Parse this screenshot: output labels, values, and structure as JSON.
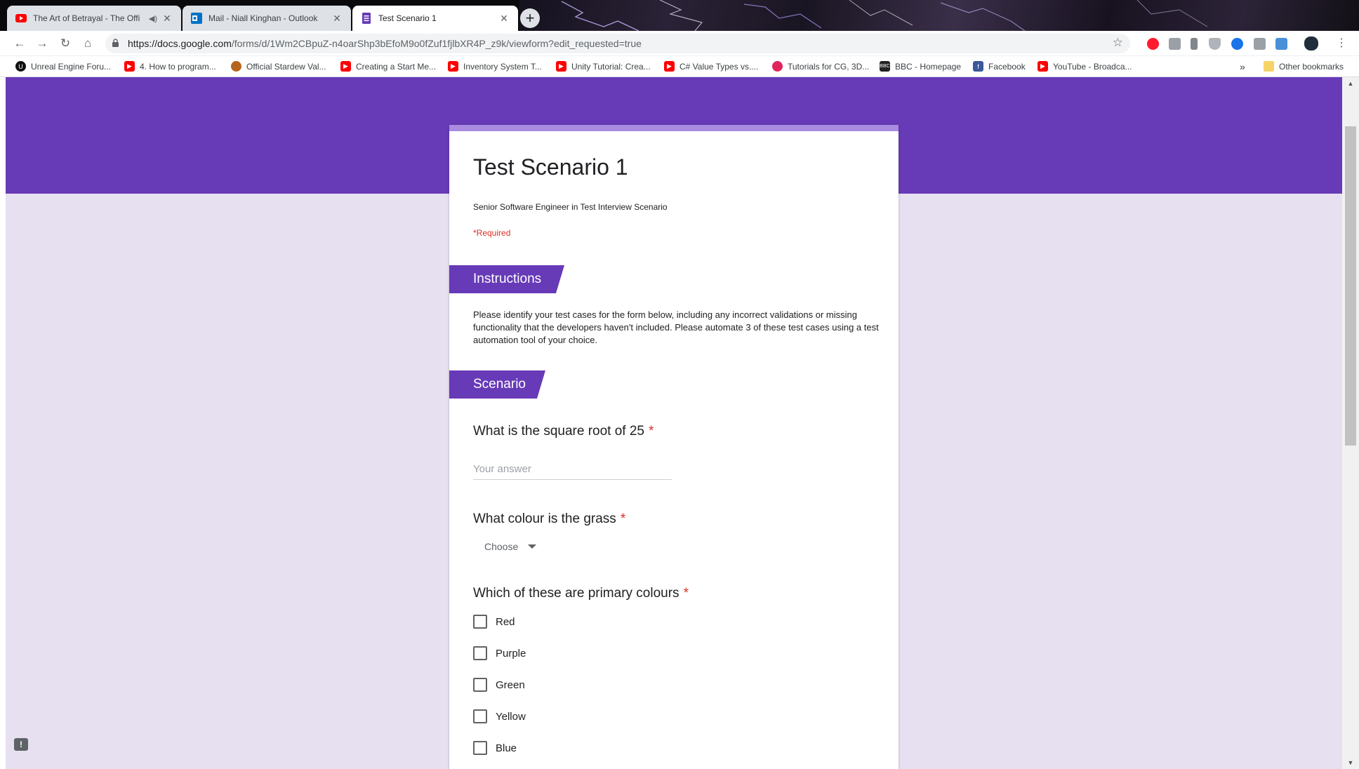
{
  "browser": {
    "tabs": [
      {
        "title": "The Art of Betrayal - The Offi",
        "favicon": "youtube-icon",
        "audio": true
      },
      {
        "title": "Mail - Niall Kinghan - Outlook",
        "favicon": "outlook-icon"
      },
      {
        "title": "Test Scenario 1",
        "favicon": "google-forms-icon",
        "active": true
      }
    ],
    "new_tab": "+",
    "url_domain": "https://docs.google.com",
    "url_path": "/forms/d/1Wm2CBpuZ-n4oarShp3bEfoM9o0fZuf1fjlbXR4P_z9k/viewform?edit_requested=true",
    "bookmarks": [
      {
        "label": "Unreal Engine Foru...",
        "icon": "unreal-icon"
      },
      {
        "label": "4. How to program...",
        "icon": "youtube-icon"
      },
      {
        "label": "Official Stardew Val...",
        "icon": "stardew-icon"
      },
      {
        "label": "Creating a Start Me...",
        "icon": "youtube-icon"
      },
      {
        "label": "Inventory System T...",
        "icon": "youtube-icon"
      },
      {
        "label": "Unity Tutorial: Crea...",
        "icon": "youtube-icon"
      },
      {
        "label": "C# Value Types vs....",
        "icon": "youtube-icon"
      },
      {
        "label": "Tutorials for CG, 3D...",
        "icon": "cgcookie-icon"
      },
      {
        "label": "BBC - Homepage",
        "icon": "bbc-icon"
      },
      {
        "label": "Facebook",
        "icon": "facebook-icon"
      },
      {
        "label": "YouTube - Broadca...",
        "icon": "youtube-icon"
      }
    ],
    "more_bookmarks": "»",
    "other_bookmarks": "Other bookmarks"
  },
  "form": {
    "title": "Test Scenario 1",
    "description": "Senior Software Engineer in Test Interview Scenario",
    "required_note": "*Required",
    "sections": [
      {
        "title": "Instructions"
      },
      {
        "title": "Scenario"
      }
    ],
    "instructions_text": "Please identify your test cases for the form below, including any incorrect validations or missing functionality that the developers haven't included.  Please automate 3 of these test cases using a test automation tool of your choice.",
    "required_marker": "*",
    "questions": [
      {
        "title": "What is the square root of 25",
        "placeholder": "Your answer"
      },
      {
        "title": "What colour is the grass",
        "selected": "Choose"
      },
      {
        "title": "Which of these are primary colours",
        "options": [
          "Red",
          "Purple",
          "Green",
          "Yellow",
          "Blue"
        ]
      }
    ]
  },
  "colors": {
    "theme": "#673ab7",
    "background": "#e6e0f1",
    "required": "#d93025"
  }
}
